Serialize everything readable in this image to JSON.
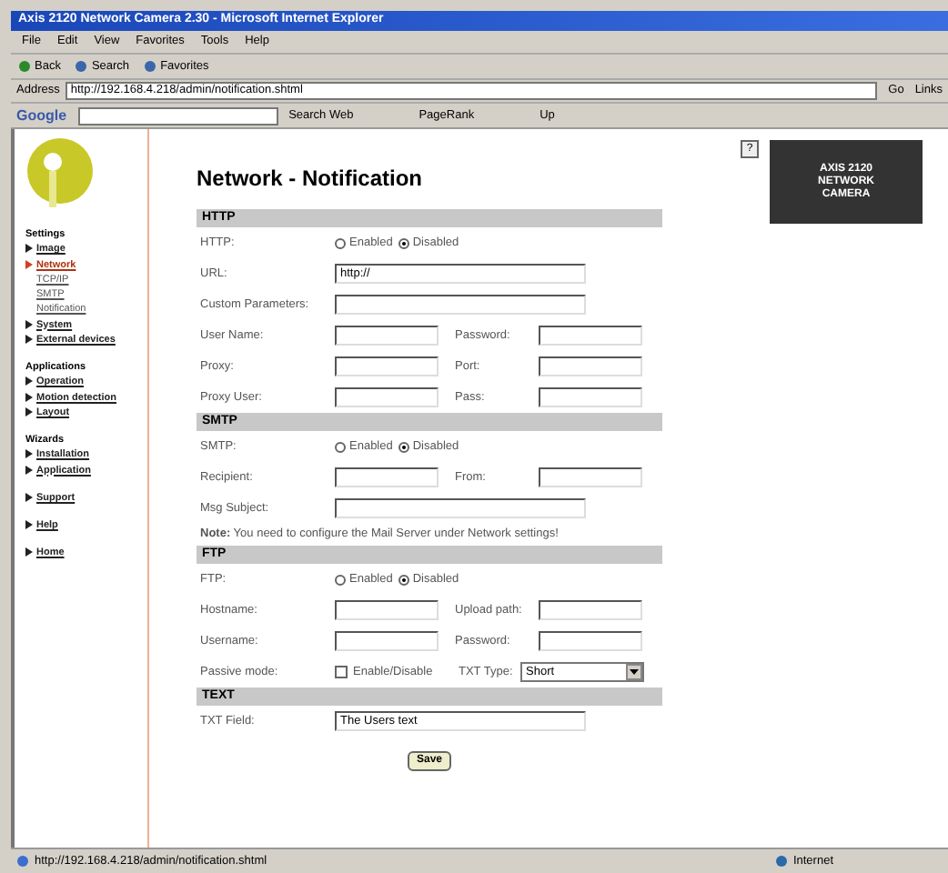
{
  "window": {
    "title": "Axis 2120 Network Camera 2.30 - Microsoft Internet Explorer"
  },
  "menu": [
    "File",
    "Edit",
    "View",
    "Favorites",
    "Tools",
    "Help"
  ],
  "toolbar": [
    "Back",
    "Search",
    "Favorites"
  ],
  "address": {
    "label": "Address",
    "value": "http://192.168.4.218/admin/notification.shtml",
    "go": "Go",
    "links": "Links"
  },
  "google_bar": {
    "logo": "Google",
    "search": "Search Web",
    "pagerank": "PageRank",
    "up": "Up"
  },
  "sidebar": [
    {
      "heading": "Settings",
      "items": [
        {
          "label": "Image",
          "selected": false
        },
        {
          "label": "Network",
          "selected": true,
          "children": [
            {
              "label": "TCP/IP"
            },
            {
              "label": "SMTP"
            },
            {
              "label": "Notification"
            }
          ]
        },
        {
          "label": "System",
          "selected": false
        },
        {
          "label": "External devices",
          "selected": false
        }
      ]
    },
    {
      "heading": "Applications",
      "items": [
        {
          "label": "Operation",
          "selected": false
        },
        {
          "label": "Motion detection",
          "selected": false
        },
        {
          "label": "Layout",
          "selected": false
        }
      ]
    },
    {
      "heading": "Wizards",
      "items": [
        {
          "label": "Installation",
          "selected": false
        },
        {
          "label": "Application",
          "selected": false
        }
      ]
    },
    {
      "items": [
        {
          "label": "Support",
          "selected": false
        }
      ]
    },
    {
      "items": [
        {
          "label": "Help",
          "selected": false
        }
      ]
    },
    {
      "items": [
        {
          "label": "Home",
          "selected": false
        }
      ]
    }
  ],
  "page_title": "Network - Notification",
  "help_button": "?",
  "brand": [
    "AXIS 2120",
    "NETWORK",
    "CAMERA"
  ],
  "sections": [
    {
      "title": "HTTP",
      "rows": [
        {
          "kind": "radio",
          "label": "HTTP:",
          "options": [
            {
              "label": "Enabled",
              "selected": false
            },
            {
              "label": "Disabled",
              "selected": true
            }
          ]
        },
        {
          "kind": "field",
          "label": "URL:",
          "value": "http://"
        },
        {
          "kind": "field",
          "label": "Custom Parameters:"
        },
        {
          "kind": "pair",
          "fields": [
            {
              "label": "User Name:"
            },
            {
              "label": "Password:"
            }
          ]
        },
        {
          "kind": "pair",
          "fields": [
            {
              "label": "Proxy:"
            },
            {
              "label": "Port:"
            }
          ]
        },
        {
          "kind": "pair",
          "fields": [
            {
              "label": "Proxy User:"
            },
            {
              "label": "Pass:"
            }
          ]
        }
      ]
    },
    {
      "title": "SMTP",
      "rows": [
        {
          "kind": "radio",
          "label": "SMTP:",
          "options": [
            {
              "label": "Enabled",
              "selected": false
            },
            {
              "label": "Disabled",
              "selected": true
            }
          ]
        },
        {
          "kind": "pair",
          "fields": [
            {
              "label": "Recipient:"
            },
            {
              "label": "From:"
            }
          ]
        },
        {
          "kind": "field",
          "label": "Msg Subject:"
        },
        {
          "kind": "note",
          "text": "**Note:** You need to configure the Mail Server under Network settings!"
        }
      ]
    },
    {
      "title": "FTP",
      "rows": [
        {
          "kind": "radio",
          "label": "FTP:",
          "options": [
            {
              "label": "Enabled",
              "selected": false
            },
            {
              "label": "Disabled",
              "selected": true
            }
          ]
        },
        {
          "kind": "pair",
          "fields": [
            {
              "label": "Hostname:"
            },
            {
              "label": "Upload path:"
            }
          ]
        },
        {
          "kind": "pair",
          "fields": [
            {
              "label": "Username:"
            },
            {
              "label": "Password:"
            }
          ]
        },
        {
          "kind": "mixed",
          "label": "Passive mode:",
          "option": "Enable/Disable",
          "checked": false,
          "select_label": "TXT Type:",
          "select_value": "Short"
        }
      ]
    },
    {
      "title": "TEXT",
      "rows": [
        {
          "kind": "field",
          "label": "TXT Field:",
          "value": "The Users text"
        }
      ]
    }
  ],
  "save": "Save",
  "status_bar": {
    "url": "http://192.168.4.218/admin/notification.shtml",
    "zone": "Internet"
  }
}
